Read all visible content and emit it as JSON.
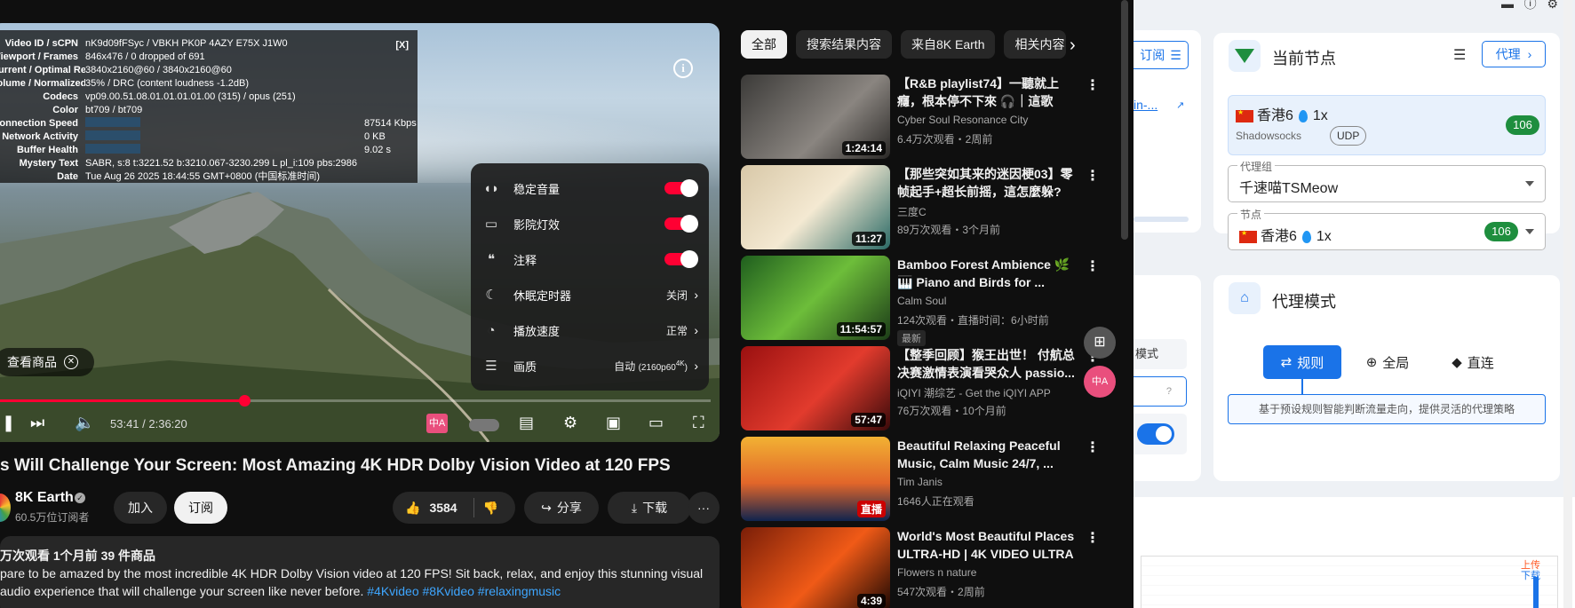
{
  "player": {
    "stats": [
      {
        "k": "Video ID / sCPN",
        "v": "nK9d09fFSyc  /  VBKH PK0P 4AZY E75X J1W0"
      },
      {
        "k": "Viewport / Frames",
        "v": "846x476 / 0 dropped of 691"
      },
      {
        "k": "Current / Optimal Res",
        "v": "3840x2160@60 / 3840x2160@60"
      },
      {
        "k": "Volume / Normalized",
        "v": "35% / DRC (content loudness -1.2dB)"
      },
      {
        "k": "Codecs",
        "v": "vp09.00.51.08.01.01.01.01.00 (315) / opus (251)"
      },
      {
        "k": "Color",
        "v": "bt709 / bt709"
      },
      {
        "k": "Connection Speed",
        "v": "",
        "rhs": "87514 Kbps"
      },
      {
        "k": "Network Activity",
        "v": "",
        "rhs": "0 KB"
      },
      {
        "k": "Buffer Health",
        "v": "",
        "rhs": "9.02 s"
      },
      {
        "k": "Mystery Text",
        "v": "SABR, s:8 t:3221.52 b:3210.067-3230.299 L pl_i:109 pbs:2986"
      },
      {
        "k": "Date",
        "v": "Tue Aug 26 2025 18:44:55 GMT+0800 (中国标准时间)"
      }
    ],
    "stats_close": "[X]",
    "info_icon": "i",
    "settings": [
      {
        "label": "稳定音量",
        "toggle": true,
        "icon": "stable-volume-icon",
        "glyph": "◖◗"
      },
      {
        "label": "影院灯效",
        "toggle": true,
        "icon": "ambient-mode-icon",
        "glyph": "▭"
      },
      {
        "label": "注释",
        "toggle": true,
        "icon": "annotations-icon",
        "glyph": "❝"
      },
      {
        "label": "休眠定时器",
        "value": "关闭",
        "icon": "sleep-timer-icon",
        "glyph": "☾"
      },
      {
        "label": "播放速度",
        "value": "正常",
        "icon": "playback-speed-icon",
        "glyph": "◔"
      },
      {
        "label": "画质",
        "value": "自动",
        "value_small": "(2160p60",
        "value_sup": "4K",
        "icon": "quality-icon",
        "glyph": "☰"
      }
    ],
    "shop_label": "查看商品",
    "time": "53:41 / 2:36:20",
    "progress": 0.344
  },
  "video": {
    "title": "s Will Challenge Your Screen: Most Amazing 4K HDR Dolby Vision Video at 120 FPS",
    "channel": "8K Earth",
    "subs": "60.5万位订阅者",
    "join": "加入",
    "subscribe": "订阅",
    "likes": "3584",
    "share": "分享",
    "download": "下载",
    "more": "···",
    "desc_meta": "万次观看  1个月前  39 件商品",
    "desc_line1": "pare to be amazed by the most incredible 4K HDR Dolby Vision video at 120 FPS! Sit back, relax, and enjoy this stunning visual",
    "desc_line2": "audio experience that will challenge your screen like never before.",
    "tags": "#4Kvideo #8Kvideo #relaxingmusic"
  },
  "chips": [
    "全部",
    "搜索结果内容",
    "来自8K Earth",
    "相关内容"
  ],
  "recs": [
    {
      "title": "【R&B playlist74】一聽就上癮，根本停不下來 🎧｜這歌單...",
      "channel": "Cyber Soul Resonance City",
      "meta": "6.4万次观看・2周前",
      "dur": "1:24:14"
    },
    {
      "title": "【那些突如其来的迷因梗03】零帧起手+超长前摇，這怎麼躲?",
      "channel": "三度C",
      "meta": "89万次观看・3个月前",
      "dur": "11:27"
    },
    {
      "title": "Bamboo Forest Ambience 🌿 🎹 Piano and Birds for ...",
      "channel": "Calm Soul",
      "meta": "124次观看・直播时间：6小时前",
      "dur": "11:54:57",
      "badge": "最新"
    },
    {
      "title": "【整季回顾】猴王出世！ 付航总决赛激情表演看哭众人 passio...",
      "channel": "iQIYI 潮综艺 - Get the iQIYI APP",
      "meta": "76万次观看・10个月前",
      "dur": "57:47"
    },
    {
      "title": "Beautiful Relaxing Peaceful Music, Calm Music 24/7, ...",
      "channel": "Tim Janis",
      "meta": "1646人正在观看",
      "dur": "直播"
    },
    {
      "title": "World's Most Beautiful Places ULTRA-HD | 4K VIDEO ULTRA ...",
      "channel": "Flowers n nature",
      "meta": "547次观看・2周前",
      "dur": "4:39"
    }
  ],
  "clash": {
    "left_btn": "订阅",
    "left_link": "in-...",
    "current_node_title": "当前节点",
    "proxy_btn": "代理",
    "node_name": "香港6",
    "node_mult": "1x",
    "node_type": "Shadowsocks",
    "node_udp": "UDP",
    "node_latency": "106",
    "group_label": "代理组",
    "group_value": "千速喵TSMeow",
    "node_label": "节点",
    "node_value": "香港6",
    "node_value_mult": "1x",
    "node_value_latency": "106",
    "mode_title": "代理模式",
    "mode_rule": "规则",
    "mode_global": "全局",
    "mode_direct": "直连",
    "mode_desc": "基于预设规则智能判断流量走向，提供灵活的代理策略",
    "left_mode": "模式",
    "left_hint": "?",
    "upload": "上传",
    "download": "下载"
  }
}
